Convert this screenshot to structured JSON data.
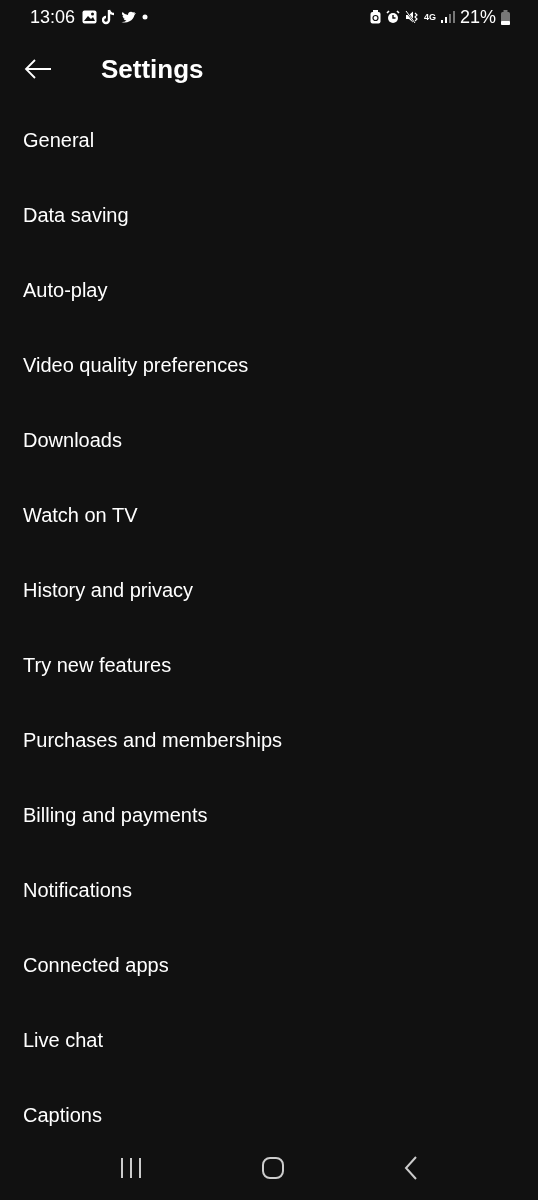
{
  "status_bar": {
    "time": "13:06",
    "network_type": "4G",
    "battery": "21%"
  },
  "header": {
    "title": "Settings"
  },
  "items": [
    {
      "label": "General"
    },
    {
      "label": "Data saving"
    },
    {
      "label": "Auto-play"
    },
    {
      "label": "Video quality preferences"
    },
    {
      "label": "Downloads"
    },
    {
      "label": "Watch on TV"
    },
    {
      "label": "History and privacy"
    },
    {
      "label": "Try new features"
    },
    {
      "label": "Purchases and memberships"
    },
    {
      "label": "Billing and payments"
    },
    {
      "label": "Notifications"
    },
    {
      "label": "Connected apps"
    },
    {
      "label": "Live chat"
    },
    {
      "label": "Captions"
    }
  ]
}
